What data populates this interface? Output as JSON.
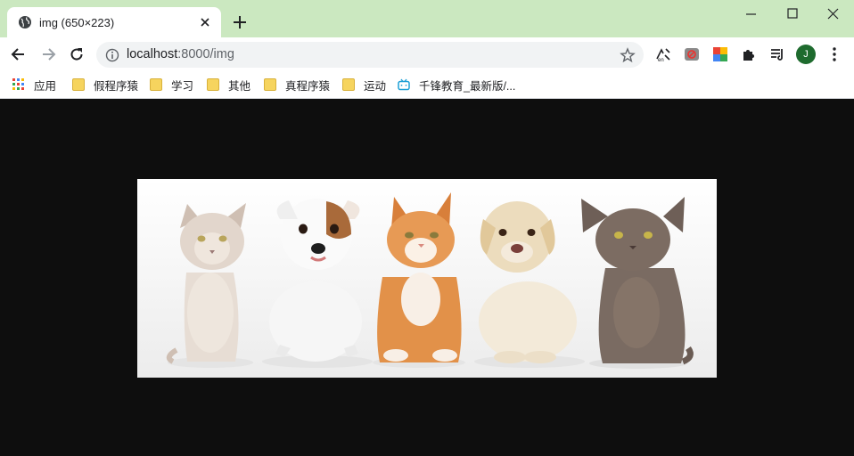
{
  "tab": {
    "title": "img (650×223)",
    "favicon": "globe-icon",
    "close_icon": "close-icon"
  },
  "window": {
    "minimize": "minimize-icon",
    "maximize": "maximize-icon",
    "close": "close-icon"
  },
  "toolbar": {
    "back": "back-arrow-icon",
    "forward": "forward-arrow-icon",
    "reload": "reload-icon",
    "url_host": "localhost",
    "url_rest": ":8000/img",
    "avatar_letter": "J"
  },
  "bookmarks": [
    {
      "label": "应用",
      "icon": "apps-grid-icon"
    },
    {
      "label": "假程序猿",
      "icon": "folder-icon"
    },
    {
      "label": "学习",
      "icon": "folder-icon"
    },
    {
      "label": "其他",
      "icon": "folder-icon"
    },
    {
      "label": "真程序猿",
      "icon": "folder-icon"
    },
    {
      "label": "运动",
      "icon": "folder-icon"
    },
    {
      "label": "千锋教育_最新版/...",
      "icon": "bilibili-icon"
    }
  ],
  "colors": {
    "tabstrip": "#cbe8c0",
    "page_background": "#0e0e0e",
    "avatar": "#1e6b2e"
  },
  "image": {
    "subject": "two cats and two puppies and a kitten sitting in a row"
  }
}
